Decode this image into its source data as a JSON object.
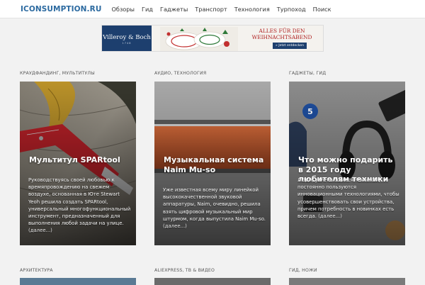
{
  "header": {
    "logo": "ICONSUMPTION.RU",
    "nav": [
      "Обзоры",
      "Гид",
      "Гаджеты",
      "Транспорт",
      "Технология",
      "Турпоход",
      "Поиск"
    ]
  },
  "banner": {
    "brand": "Villeroy & Boch",
    "brand_sub": "1748",
    "headline_1": "ALLES FÜR DEN",
    "headline_2": "WEIHNACHTSABEND",
    "button": "» Jetzt entdecken"
  },
  "articles": [
    {
      "category": "КРАУДФАНДИНГ, МУЛЬТИТУЛЫ",
      "title": "Мультитул SPARtool",
      "excerpt": "Руководствуясь своей любовью к времяпровождению на свежем воздухе, основанная в Юте Stewart Yeoh решила создать SPARtool, универсальный многофункциональный инструмент, предназначенный для выполнения любой задачи на улице.",
      "more": "(далее...)"
    },
    {
      "category": "АУДИО, ТЕХНОЛОГИЯ",
      "title": "Музыкальная система Naim Mu-so",
      "excerpt": "Уже известная всему миру линейкой высококачественной звуковой аппаратуры, Naim, очевидно, решила взять цифровой музыкальный мир штурмом, когда выпустила Naim Mu-so.",
      "more": "(далее...)"
    },
    {
      "category": "ГАДЖЕТЫ, ГИД",
      "title": "Что можно подарить в 2015 году любителям техники",
      "excerpt": "Люди, увлекающиеся техникой, постоянно пользуются инновационными технологиями, чтобы усовершенствовать свои устройства, причем потребность в новинках есть всегда.",
      "more": "(далее...)"
    }
  ],
  "next_categories": [
    "АРХИТЕКТУРА",
    "ALIEXPRESS, ТВ & ВИДЕО",
    "ГИД, НОЖИ"
  ],
  "colors": {
    "logo": "#2c6aa0",
    "page_bg": "#f2f2f2",
    "banner_brand_bg": "#1d3f6e",
    "banner_headline": "#b02020"
  }
}
